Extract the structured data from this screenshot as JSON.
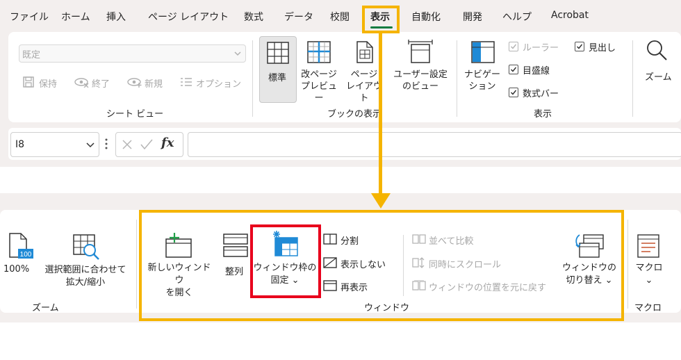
{
  "menu": {
    "tabs": [
      {
        "id": "file",
        "label": "ファイル"
      },
      {
        "id": "home",
        "label": "ホーム"
      },
      {
        "id": "insert",
        "label": "挿入"
      },
      {
        "id": "page-layout",
        "label": "ページ レイアウト"
      },
      {
        "id": "formulas",
        "label": "数式"
      },
      {
        "id": "data",
        "label": "データ"
      },
      {
        "id": "review",
        "label": "校閲"
      },
      {
        "id": "view",
        "label": "表示"
      },
      {
        "id": "automate",
        "label": "自動化"
      },
      {
        "id": "developer",
        "label": "開発"
      },
      {
        "id": "help",
        "label": "ヘルプ"
      },
      {
        "id": "acrobat",
        "label": "Acrobat"
      }
    ],
    "active_tab": "表示"
  },
  "sheet_view": {
    "dropdown_value": "既定",
    "keep_label": "保持",
    "exit_label": "終了",
    "new_label": "新規",
    "options_label": "オプション",
    "group_label": "シート ビュー"
  },
  "workbook_views": {
    "normal_label": "標準",
    "page_break_label": "改ページ\nプレビュー",
    "page_layout_label": "ページ\nレイアウト",
    "custom_views_label": "ユーザー設定\nのビュー",
    "group_label": "ブックの表示"
  },
  "show": {
    "navigation_label": "ナビゲー\nション",
    "ruler_label": "ルーラー",
    "gridlines_label": "目盛線",
    "formula_bar_label": "数式バー",
    "headings_label": "見出し",
    "group_label": "表示"
  },
  "zoom_top_label": "ズーム",
  "formula_bar": {
    "name_box": "I8",
    "fx": "fx"
  },
  "zoom_group": {
    "zoom_100_label": "100%",
    "zoom_selection_label": "選択範囲に合わせて\n拡大/縮小",
    "group_label": "ズーム",
    "icon_text": "100"
  },
  "window_group": {
    "new_window_label": "新しいウィンドウ\nを開く",
    "arrange_label": "整列",
    "freeze_label": "ウィンドウ枠の\n固定 ⌄",
    "split_label": "分割",
    "hide_label": "表示しない",
    "unhide_label": "再表示",
    "side_by_side_label": "並べて比較",
    "sync_scroll_label": "同時にスクロール",
    "reset_position_label": "ウィンドウの位置を元に戻す",
    "switch_label": "ウィンドウの\n切り替え ⌄",
    "group_label": "ウィンドウ"
  },
  "macro_group": {
    "macro_label": "マクロ\n⌄",
    "group_label": "マクロ"
  },
  "colors": {
    "highlight_orange": "#f5b400",
    "highlight_red": "#e8001c",
    "accent_blue": "#1f8ad6",
    "active_underline": "#107c41"
  }
}
